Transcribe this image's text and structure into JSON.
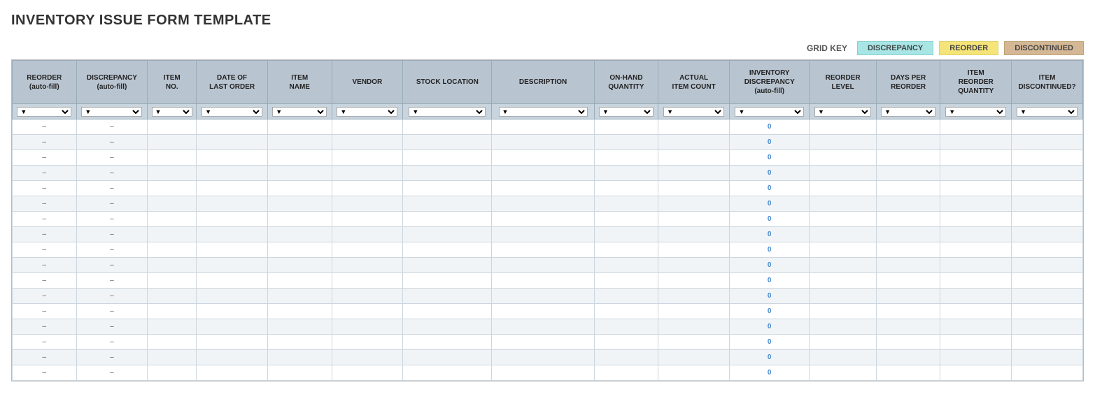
{
  "title": "INVENTORY ISSUE FORM TEMPLATE",
  "gridKey": {
    "label": "GRID KEY",
    "badges": [
      {
        "label": "DISCREPANCY",
        "class": "key-discrepancy"
      },
      {
        "label": "REORDER",
        "class": "key-reorder"
      },
      {
        "label": "DISCONTINUED",
        "class": "key-discontinued"
      }
    ]
  },
  "columns": [
    {
      "id": "reorder",
      "label": "REORDER\n(auto-fill)",
      "class": "col-reorder"
    },
    {
      "id": "discrepancy",
      "label": "DISCREPANCY\n(auto-fill)",
      "class": "col-discrepancy"
    },
    {
      "id": "item-no",
      "label": "ITEM\nNO.",
      "class": "col-item-no"
    },
    {
      "id": "date",
      "label": "DATE OF\nLAST ORDER",
      "class": "col-date"
    },
    {
      "id": "item-name",
      "label": "ITEM\nNAME",
      "class": "col-item-name"
    },
    {
      "id": "vendor",
      "label": "VENDOR",
      "class": "col-vendor"
    },
    {
      "id": "stock",
      "label": "STOCK LOCATION",
      "class": "col-stock"
    },
    {
      "id": "description",
      "label": "DESCRIPTION",
      "class": "col-description"
    },
    {
      "id": "onhand",
      "label": "ON-HAND\nQUANTITY",
      "class": "col-onhand"
    },
    {
      "id": "actual",
      "label": "ACTUAL\nITEM COUNT",
      "class": "col-actual"
    },
    {
      "id": "inv-disc",
      "label": "INVENTORY\nDISCREPANCY\n(auto-fill)",
      "class": "col-inv-disc"
    },
    {
      "id": "reorder-lvl",
      "label": "REORDER\nLEVEL",
      "class": "col-reorder-lvl"
    },
    {
      "id": "days",
      "label": "DAYS PER\nREORDER",
      "class": "col-days"
    },
    {
      "id": "item-reorder",
      "label": "ITEM\nREORDER\nQUANTITY",
      "class": "col-item-reorder"
    },
    {
      "id": "discontinued",
      "label": "ITEM\nDISCONTINUED?",
      "class": "col-discontinued"
    }
  ],
  "rows": 17,
  "dash": "–",
  "zero": "0"
}
